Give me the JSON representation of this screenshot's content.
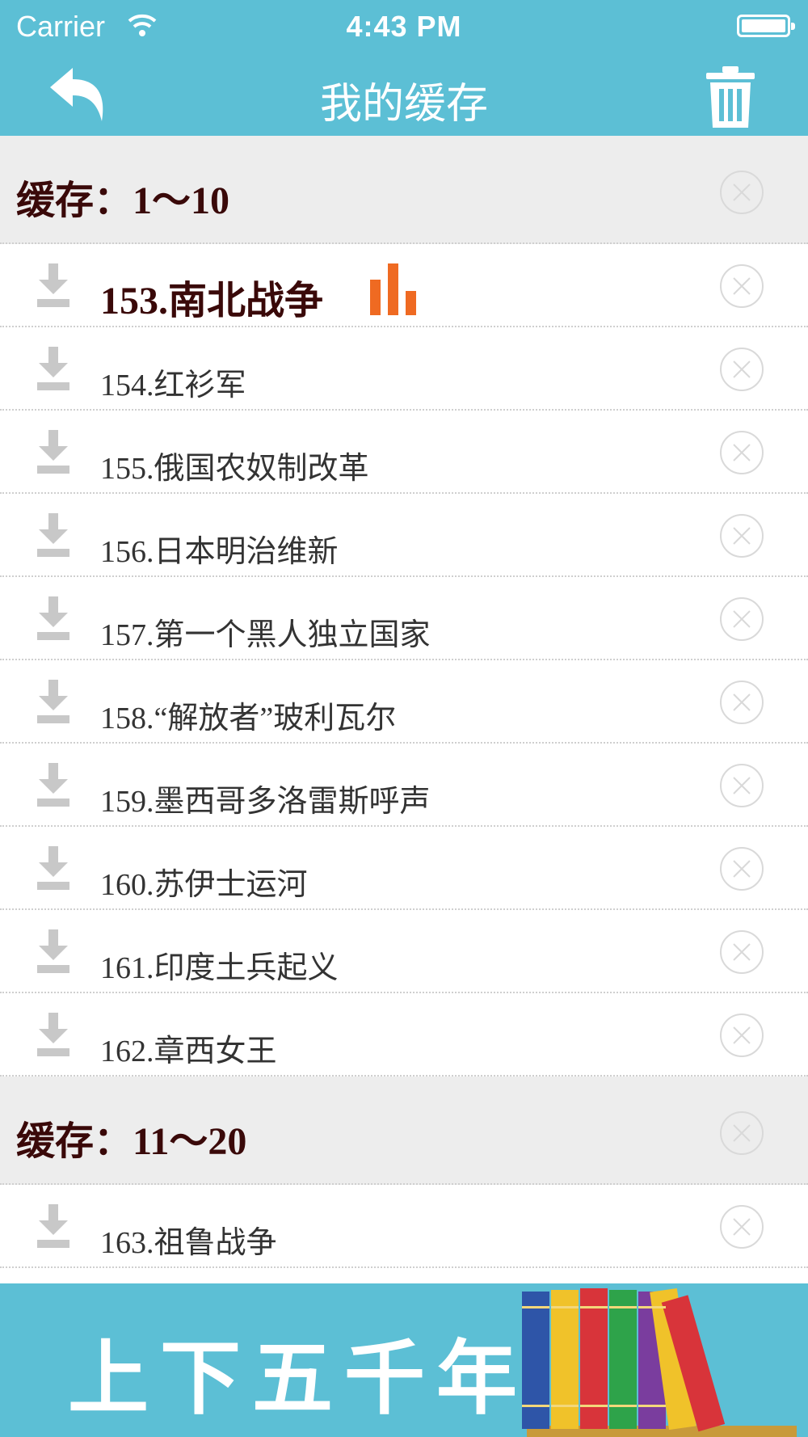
{
  "status": {
    "carrier": "Carrier",
    "time": "4:43 PM"
  },
  "header": {
    "title": "我的缓存",
    "back_icon": "undo-arrow-icon",
    "trash_icon": "trash-icon"
  },
  "colors": {
    "accent": "#5cbfd5",
    "section_bg": "#ededed",
    "active_text": "#3a0909",
    "equalizer": "#ef6a22",
    "icon_gray": "#c8c8c8"
  },
  "sections": [
    {
      "label": "缓存：",
      "range": "1～10",
      "items": [
        {
          "title": "153.南北战争",
          "playing": true
        },
        {
          "title": "154.红衫军"
        },
        {
          "title": "155.俄国农奴制改革"
        },
        {
          "title": "156.日本明治维新"
        },
        {
          "title": "157.第一个黑人独立国家"
        },
        {
          "title": "158.“解放者”玻利瓦尔"
        },
        {
          "title": "159.墨西哥多洛雷斯呼声"
        },
        {
          "title": "160.苏伊士运河"
        },
        {
          "title": "161.印度土兵起义"
        },
        {
          "title": "162.章西女王"
        }
      ]
    },
    {
      "label": "缓存：",
      "range": "11～20",
      "items": [
        {
          "title": "163.祖鲁战争"
        }
      ]
    }
  ],
  "banner": {
    "text": "上下五千年"
  }
}
